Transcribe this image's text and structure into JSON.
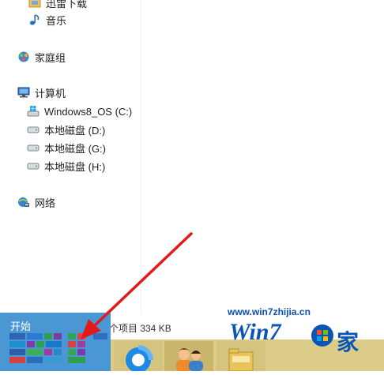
{
  "nav": {
    "items": [
      {
        "label": "迅雷下载",
        "icon": "download-folder-icon"
      },
      {
        "label": "音乐",
        "icon": "music-note-icon"
      },
      {
        "label": "家庭组",
        "icon": "homegroup-icon"
      },
      {
        "label": "计算机",
        "icon": "computer-icon"
      },
      {
        "label": "Windows8_OS (C:)",
        "icon": "system-drive-icon"
      },
      {
        "label": "本地磁盘 (D:)",
        "icon": "hard-drive-icon"
      },
      {
        "label": "本地磁盘 (G:)",
        "icon": "hard-drive-icon"
      },
      {
        "label": "本地磁盘 (H:)",
        "icon": "hard-drive-icon"
      },
      {
        "label": "网络",
        "icon": "network-icon"
      }
    ]
  },
  "status_bar": {
    "text": "个项目  334 KB"
  },
  "start_panel": {
    "title": "开始"
  },
  "watermark": {
    "url": "www.win7zhijia.cn",
    "logo_text": "Win7",
    "logo_suffix": "家"
  },
  "colors": {
    "start_blue": "#4a97d4",
    "taskbar": "#dccc8a",
    "arrow": "#e11b1b",
    "watermark": "#0b55b8"
  }
}
